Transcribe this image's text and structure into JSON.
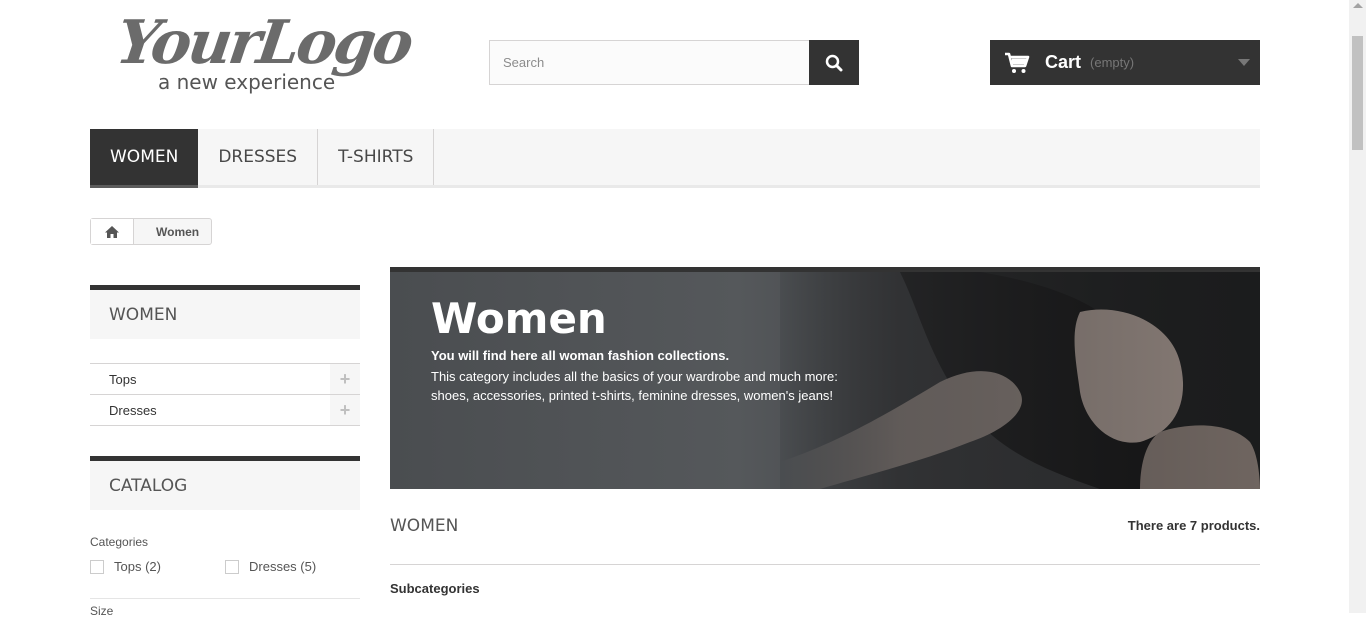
{
  "header": {
    "logo_script": "YourLogo",
    "logo_tagline": "a new experience",
    "search": {
      "placeholder": "Search",
      "value": ""
    },
    "cart": {
      "label": "Cart",
      "status": "(empty)"
    }
  },
  "nav": {
    "items": [
      {
        "label": "WOMEN",
        "active": true
      },
      {
        "label": "DRESSES",
        "active": false
      },
      {
        "label": "T-SHIRTS",
        "active": false
      }
    ]
  },
  "breadcrumb": {
    "current": "Women"
  },
  "sidebar": {
    "category_block_title": "WOMEN",
    "categories": [
      {
        "label": "Tops"
      },
      {
        "label": "Dresses"
      }
    ],
    "catalog_title": "CATALOG",
    "filter_categories_heading": "Categories",
    "filter_options": [
      {
        "label": "Tops (2)"
      },
      {
        "label": "Dresses (5)"
      }
    ],
    "filter_size_heading": "Size"
  },
  "main": {
    "banner": {
      "title": "Women",
      "lead": "You will find here all woman fashion collections.",
      "text": "This category includes all the basics of your wardrobe and much more: shoes, accessories, printed t-shirts, feminine dresses, women's jeans!"
    },
    "heading": "WOMEN",
    "product_count": "There are 7 products.",
    "subcategories_label": "Subcategories"
  },
  "colors": {
    "dark": "#333333",
    "nav_bg": "#f6f6f6",
    "border": "#d6d4d4"
  },
  "icons": [
    "search-icon",
    "cart-icon",
    "chevron-down-icon",
    "home-icon",
    "plus-icon"
  ]
}
